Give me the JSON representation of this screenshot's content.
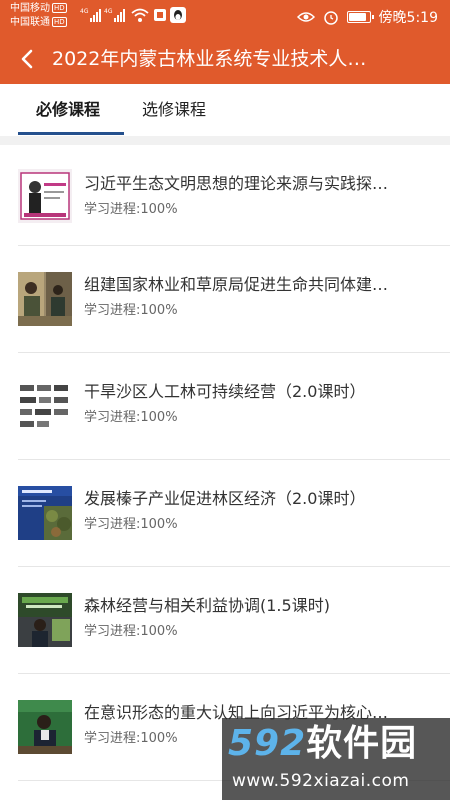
{
  "status_bar": {
    "carrier_1": "中国移动",
    "carrier_2": "中国联通",
    "hd_badge": "HD",
    "net_badge": "4G",
    "time": "傍晚5:19",
    "battery_level": 0.85
  },
  "header": {
    "title": "2022年内蒙古林业系统专业技术人…"
  },
  "tabs": [
    {
      "label": "必修课程",
      "selected": true
    },
    {
      "label": "选修课程",
      "selected": false
    }
  ],
  "courses": [
    {
      "title": "习近平生态文明思想的理论来源与实践探…",
      "progress": "学习进程:100%"
    },
    {
      "title": "组建国家林业和草原局促进生命共同体建…",
      "progress": "学习进程:100%"
    },
    {
      "title": "干旱沙区人工林可持续经营（2.0课时）",
      "progress": "学习进程:100%"
    },
    {
      "title": "发展榛子产业促进林区经济（2.0课时）",
      "progress": "学习进程:100%"
    },
    {
      "title": "森林经营与相关利益协调(1.5课时)",
      "progress": "学习进程:100%"
    },
    {
      "title": "在意识形态的重大认知上向习近平为核心…",
      "progress": "学习进程:100%"
    }
  ],
  "watermark": {
    "logo_num": "592",
    "logo_cn": "软件园",
    "url": "www.592xiazai.com"
  },
  "colors": {
    "brand": "#e05a2c",
    "tab_indicator": "#24508d"
  }
}
